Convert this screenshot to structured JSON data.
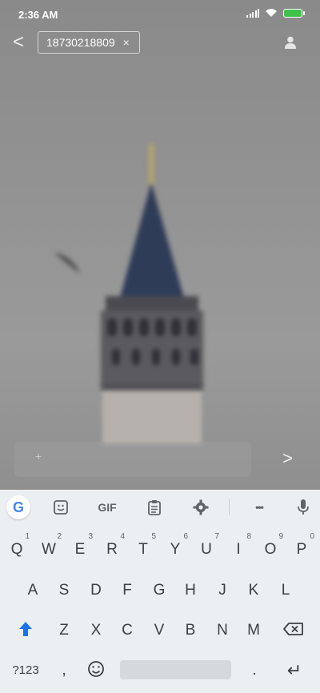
{
  "status_bar": {
    "time": "2:36 AM"
  },
  "header": {
    "back_label": "<",
    "recipient": "18730218809",
    "remove_label": "×"
  },
  "compose": {
    "plus_label": "+",
    "send_label": ">"
  },
  "keyboard": {
    "toolbar": {
      "gif_label": "GIF",
      "more_label": "•••"
    },
    "row1": [
      {
        "k": "Q",
        "n": "1"
      },
      {
        "k": "W",
        "n": "2"
      },
      {
        "k": "E",
        "n": "3"
      },
      {
        "k": "R",
        "n": "4"
      },
      {
        "k": "T",
        "n": "5"
      },
      {
        "k": "Y",
        "n": "6"
      },
      {
        "k": "U",
        "n": "7"
      },
      {
        "k": "I",
        "n": "8"
      },
      {
        "k": "O",
        "n": "9"
      },
      {
        "k": "P",
        "n": "0"
      }
    ],
    "row2": [
      "A",
      "S",
      "D",
      "F",
      "G",
      "H",
      "J",
      "K",
      "L"
    ],
    "row3": [
      "Z",
      "X",
      "C",
      "V",
      "B",
      "N",
      "M"
    ],
    "row4": {
      "symbols_label": "?123",
      "comma_label": ",",
      "period_label": ".",
      "enter_label": "↵"
    }
  }
}
